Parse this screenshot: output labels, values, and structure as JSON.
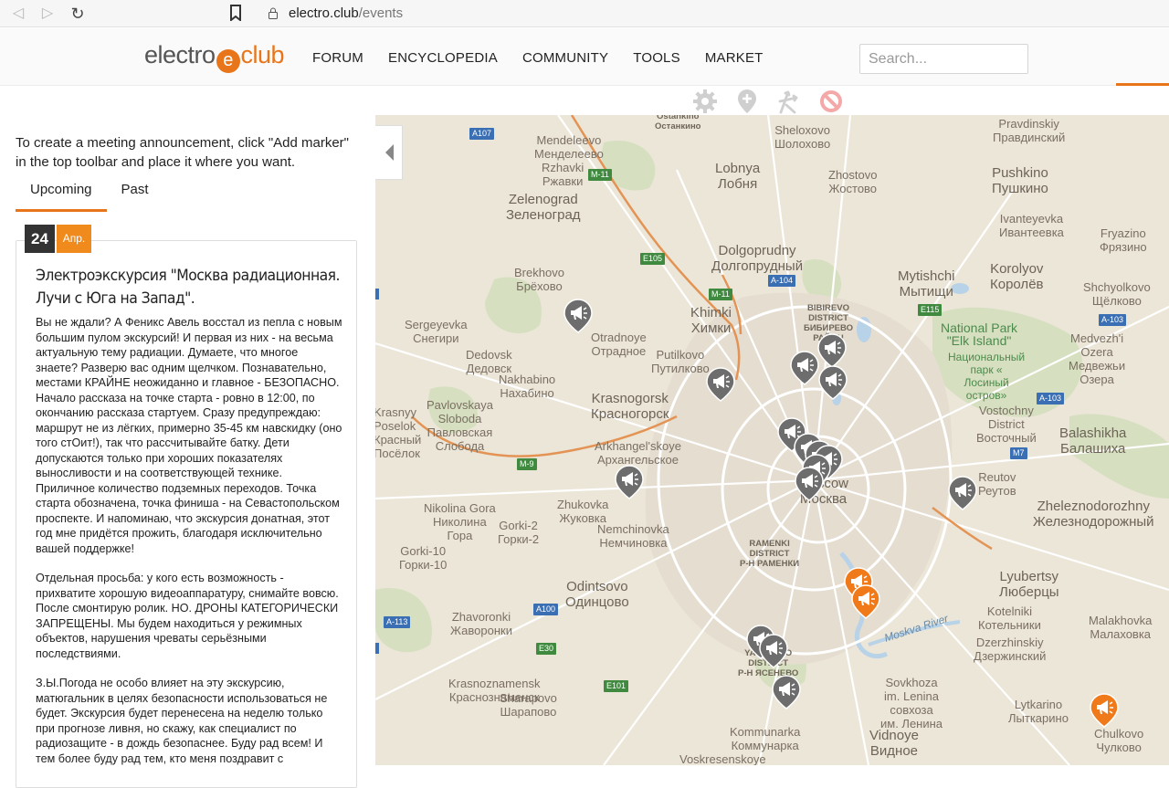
{
  "browser": {
    "domain": "electro.club",
    "path": "/events"
  },
  "header": {
    "logo_left": "electro",
    "logo_mark": "e",
    "logo_right": "club",
    "menu": [
      "FORUM",
      "ENCYCLOPEDIA",
      "COMMUNITY",
      "TOOLS",
      "MARKET"
    ],
    "search_placeholder": "Search..."
  },
  "toolbar": [
    "gear-icon",
    "add-marker-icon",
    "route-icon",
    "forbidden-icon"
  ],
  "left_panel": {
    "intro": "To create a meeting announcement, click \"Add marker\" in the top toolbar and place it where you want.",
    "tabs": [
      "Upcoming",
      "Past"
    ],
    "event": {
      "day": "24",
      "month": "Апр.",
      "title": "Электроэкскурсия \"Москва радиационная. Лучи с Юга на Запад\".",
      "paragraphs": [
        "Вы не ждали? А Феникс Авель восстал из пепла с новым большим пулом экскурсий! И первая из них - на весьма актуальную тему радиации. Думаете, что многое знаете? Разверю вас одним щелчком. Познавательно, местами КРАЙНЕ неожиданно и главное - БЕЗОПАСНО. Начало рассказа на точке старта - ровно в 12:00, по окончанию рассказа стартуем. Сразу предупреждаю: маршрут не из лёгких, примерно 35-45 км навскидку (оно того стОит!), так что рассчитывайте батку. Дети допускаются только при хороших показателях выносливости и на соответствующей технике. Приличное количество подземных переходов. Точка старта обозначена, точка финиша - на Севастопольском проспекте. И напоминаю, что экскурсия донатная, этот год мне придётся прожить, благодаря исключительно вашей поддержке!",
        "Отдельная просьба: у кого есть возможность - прихватите хорошую видеоаппаратуру, снимайте вовсю. После смонтирую ролик. НО. ДРОНЫ КАТЕГОРИЧЕСКИ ЗАПРЕЩЕНЫ. Мы будем находиться у режимных объектов, нарушения чреваты серьёзными последствиями.",
        "З.Ы.Погода не особо влияет на эту экскурсию, матюгальник в целях безопасности использоваться не будет. Экскурсия будет перенесена на неделю только при прогнозе ливня, но скажу, как специалист по радиозащите - в дождь безопаснее. Буду рад всем! И тем более буду рад тем, кто меня поздравит с"
      ]
    }
  },
  "map": {
    "places": [
      {
        "t": "Ostankino\nОстанкино",
        "c": "small"
      },
      {
        "t": "Sheloxovo\nШолохово",
        "c": ""
      },
      {
        "t": "Pravdinskiy\nПравдинский",
        "c": ""
      },
      {
        "t": "Mendeleevo\nМенделеево",
        "c": ""
      },
      {
        "t": "Rzhavki\nРжавки",
        "c": ""
      },
      {
        "t": "Lobnya\nЛобня",
        "c": "big"
      },
      {
        "t": "Zhostovo\nЖостово",
        "c": ""
      },
      {
        "t": "Pushkino\nПушкино",
        "c": "big"
      },
      {
        "t": "Zelenograd\nЗеленоград",
        "c": "big"
      },
      {
        "t": "Ivanteyevka\nИвантеевка",
        "c": ""
      },
      {
        "t": "Fryazino\nФрязино",
        "c": ""
      },
      {
        "t": "Dolgoprudny\nДолгопрудный",
        "c": "big"
      },
      {
        "t": "Mytishchi\nМытищи",
        "c": "big"
      },
      {
        "t": "Korolyov\nКоролёв",
        "c": "big"
      },
      {
        "t": "Shchyolkovo\nЩёлково",
        "c": ""
      },
      {
        "t": "Brekhovo\nБрёхово",
        "c": ""
      },
      {
        "t": "Khimki\nХимки",
        "c": "big"
      },
      {
        "t": "BIBIREVO\nDISTRICT\nБИБИРЕВО\nРАЙОН",
        "c": "small"
      },
      {
        "t": "National Park\n\"Elk Island\"",
        "c": "park big"
      },
      {
        "t": "Национальный\nпарк «\nЛосиный\nостров»",
        "c": "park"
      },
      {
        "t": "Medvezh'i\nOzera\nМедвежьи\nОзера",
        "c": ""
      },
      {
        "t": "Sergeyevka\nСнегири",
        "c": ""
      },
      {
        "t": "Otradnoye\nОтрадное",
        "c": ""
      },
      {
        "t": "Dedovsk\nДедовск",
        "c": ""
      },
      {
        "t": "Putilkovo\nПутилково",
        "c": ""
      },
      {
        "t": "Nakhabino\nНахабино",
        "c": ""
      },
      {
        "t": "Krasnogorsk\nКрасногорск",
        "c": "big"
      },
      {
        "t": "Pavlovskaya\nSloboda\nПавловская\nСлобода",
        "c": ""
      },
      {
        "t": "Krasnyy\nPoselok\nКрасный\nПосёлок",
        "c": ""
      },
      {
        "t": "Vostochny\nDistrict\nВосточный",
        "c": ""
      },
      {
        "t": "Balashikha\nБалашиха",
        "c": "big"
      },
      {
        "t": "Arkhangel'skoye\nАрхангельское",
        "c": ""
      },
      {
        "t": "Moscow\nМосква",
        "c": "big"
      },
      {
        "t": "Reutov\nРеутов",
        "c": ""
      },
      {
        "t": "Zheleznodorozhny\nЖелезнодорожный",
        "c": "big"
      },
      {
        "t": "Nikolina Gora\nНиколина\nГора",
        "c": ""
      },
      {
        "t": "Zhukovka\nЖуковка",
        "c": ""
      },
      {
        "t": "Gorki-2\nГорки-2",
        "c": ""
      },
      {
        "t": "Nemchinovka\nНемчиновка",
        "c": ""
      },
      {
        "t": "Gorki-10\nГорки-10",
        "c": ""
      },
      {
        "t": "RAMENKI\nDISTRICT\nР-Н РАМЕНКИ",
        "c": "small"
      },
      {
        "t": "Odintsovo\nОдинцово",
        "c": "big"
      },
      {
        "t": "Lyubertsy\nЛюберцы",
        "c": "big"
      },
      {
        "t": "Kotelniki\nКотельники",
        "c": ""
      },
      {
        "t": "Malakhovka\nМалаховка",
        "c": ""
      },
      {
        "t": "Zhavoronki\nЖаворонки",
        "c": ""
      },
      {
        "t": "Moskva River",
        "c": "water"
      },
      {
        "t": "Dzerzhinskiy\nДзержинский",
        "c": ""
      },
      {
        "t": "YASENEVO\nDISTRICT\nР-Н ЯСЕНЕВО",
        "c": "small"
      },
      {
        "t": "Krasnoznamensk\nКраснознаменск",
        "c": ""
      },
      {
        "t": "Sharapovo\nШарапово",
        "c": ""
      },
      {
        "t": "Sovkhoza\nim. Lenina\nсовхоза\nим. Ленина",
        "c": ""
      },
      {
        "t": "Lytkarino\nЛыткарино",
        "c": ""
      },
      {
        "t": "Chulkovo\nЧулково",
        "c": ""
      },
      {
        "t": "Kommunarka\nКоммунарка",
        "c": ""
      },
      {
        "t": "Vidnoye\nВидное",
        "c": "big"
      },
      {
        "t": "Voskresenskoye",
        "c": ""
      }
    ],
    "shields": [
      "A107",
      "M-11",
      "E105",
      "M-11",
      "A-104",
      "E115",
      "A-103",
      "A-103",
      "M7",
      "M-9",
      "A100",
      "A-113",
      "E30",
      "E101"
    ]
  },
  "colors": {
    "accent": "#e8751a",
    "marker_gray": "#6d6d6d",
    "marker_orange": "#f07a1a"
  }
}
